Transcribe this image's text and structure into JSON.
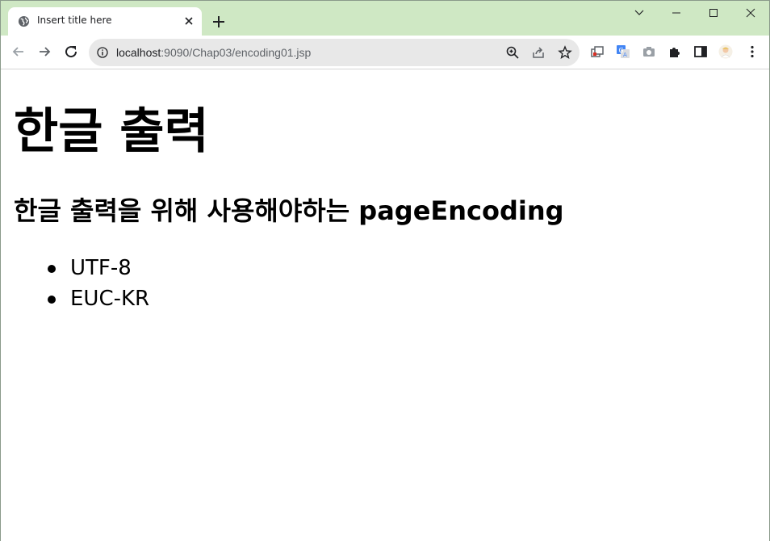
{
  "browser": {
    "tab": {
      "title": "Insert title here",
      "favicon": "globe-icon"
    },
    "window_controls": [
      "chevron-down-icon",
      "minimize-icon",
      "maximize-icon",
      "close-icon"
    ],
    "address_bar": {
      "host": "localhost",
      "path": ":9090/Chap03/encoding01.jsp"
    },
    "toolbar_icons": [
      "back-icon",
      "forward-icon",
      "reload-icon",
      "info-icon",
      "zoom-icon",
      "share-icon",
      "bookmark-star-icon"
    ],
    "extension_icons": [
      "screen-capture-icon",
      "translate-icon",
      "camera-icon",
      "extensions-puzzle-icon",
      "side-panel-icon",
      "profile-avatar-icon",
      "menu-kebab-icon"
    ]
  },
  "page": {
    "heading1": "한글 출력",
    "heading2": "한글 출력을 위해 사용해야하는 pageEncoding",
    "list": [
      "UTF-8",
      "EUC-KR"
    ]
  }
}
